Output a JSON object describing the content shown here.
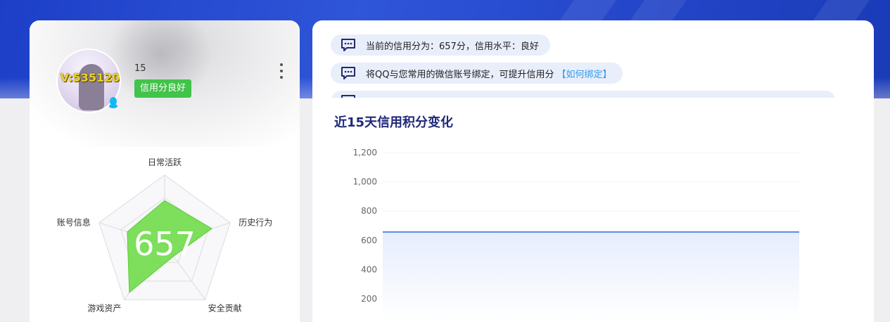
{
  "profile": {
    "avatar_badge_text": "V:535120",
    "username": "15",
    "credit_badge": "信用分良好",
    "score": "657",
    "radar": {
      "axes": [
        "日常活跃",
        "历史行为",
        "安全贡献",
        "游戏资产",
        "账号信息"
      ],
      "values": [
        0.63,
        0.72,
        0.22,
        0.87,
        0.57
      ]
    }
  },
  "tips": [
    {
      "text": "当前的信用分为：657分，信用水平：良好",
      "link": ""
    },
    {
      "text": "将QQ与您常用的微信账号绑定，可提升信用分",
      "link": "【如何绑定】"
    }
  ],
  "chart": {
    "title": "近15天信用积分变化"
  },
  "chart_data": {
    "type": "area",
    "title": "近15天信用积分变化",
    "xlabel": "",
    "ylabel": "",
    "y_ticks": [
      "1,200",
      "1,000",
      "800",
      "600",
      "400",
      "200"
    ],
    "ylim": [
      200,
      1200
    ],
    "series": [
      {
        "values": [
          657,
          657,
          657,
          657,
          657,
          657,
          657,
          657,
          657,
          657,
          657,
          657,
          657,
          657,
          657
        ]
      }
    ],
    "colors": {
      "line": "#5b8fe8",
      "fill": "#e6edfd"
    },
    "grid": true
  },
  "colors": {
    "banner": "#2446c9",
    "credit_green": "#42c34a",
    "radar_fill": "#6fdc4a",
    "title_navy": "#21297a",
    "link_blue": "#2f9be9"
  }
}
